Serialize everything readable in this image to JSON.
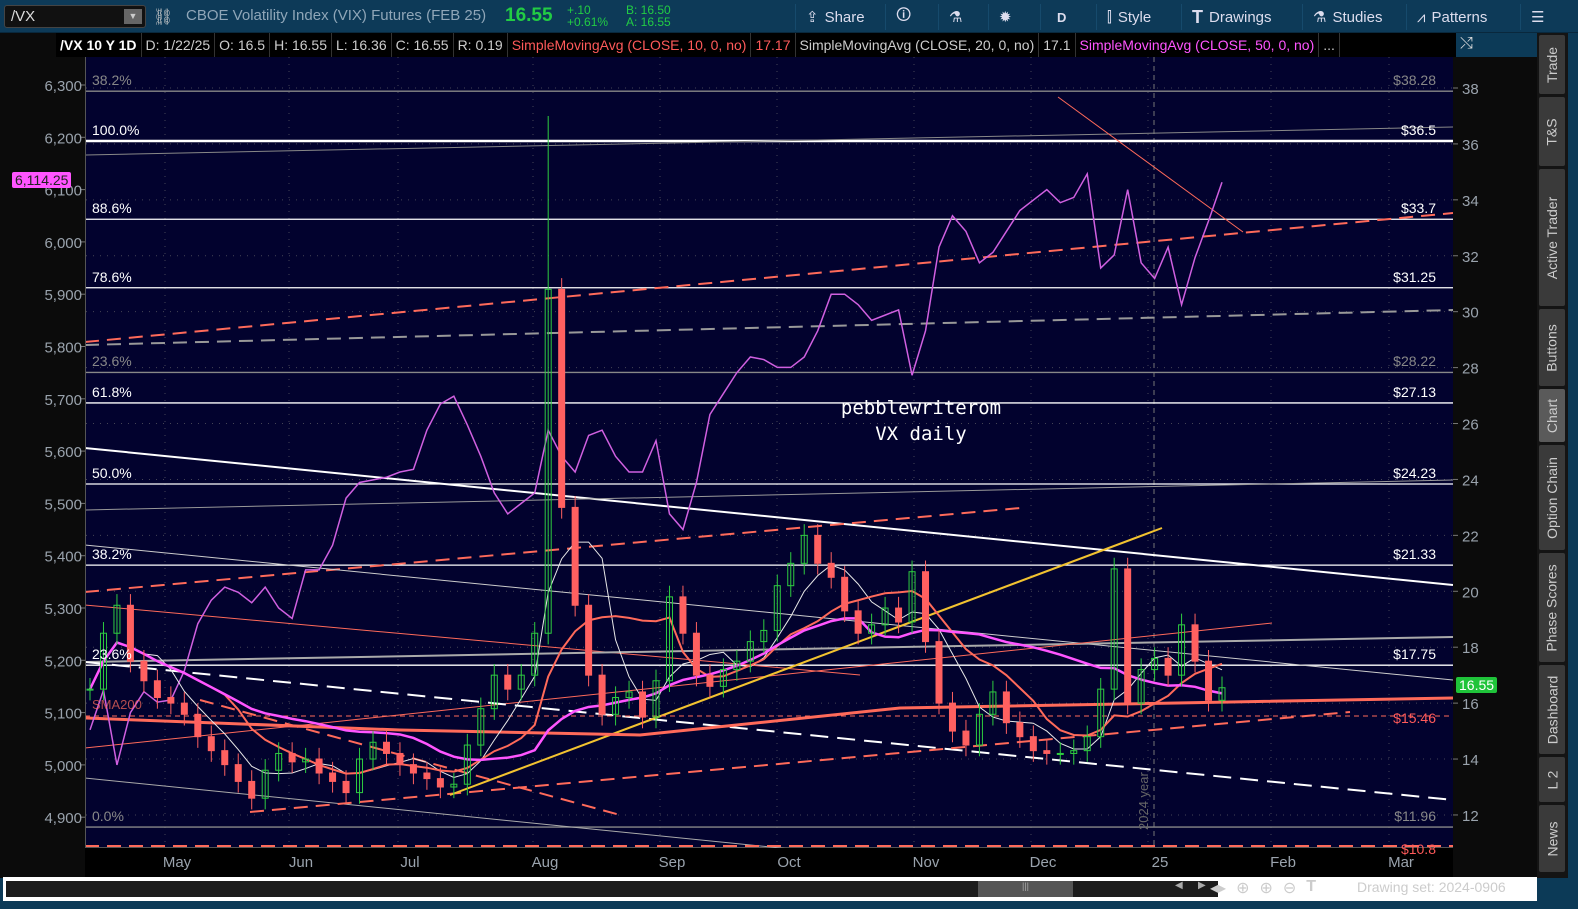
{
  "toolbar": {
    "symbol": "/VX",
    "description": "CBOE Volatility Index (VIX) Futures (FEB 25)",
    "last": "16.55",
    "change": "+.10",
    "change_pct": "+0.61%",
    "bid": "B: 16.50",
    "ask": "A: 16.55",
    "share": "Share",
    "period": "D",
    "style": "Style",
    "drawings": "Drawings",
    "studies": "Studies",
    "patterns": "Patterns"
  },
  "infobar": {
    "title": "/VX 10 Y 1D",
    "date": "D: 1/22/25",
    "open": "O: 16.5",
    "high": "H: 16.55",
    "low": "L: 16.36",
    "close": "C: 16.55",
    "range": "R: 0.19",
    "sma10": "SimpleMovingAvg (CLOSE, 10, 0, no)",
    "sma10_val": "17.17",
    "sma20": "SimpleMovingAvg (CLOSE, 20, 0, no)",
    "sma20_val": "17.1",
    "sma50": "SimpleMovingAvg (CLOSE, 50, 0, no)",
    "more": "..."
  },
  "sidebar": [
    "Trade",
    "T&S",
    "Active Trader",
    "Buttons",
    "Chart",
    "Option Chain",
    "Phase Scores",
    "Dashboard",
    "L 2",
    "News"
  ],
  "bottom": {
    "drawing_set": "Drawing set: 2024-0906"
  },
  "annotation": {
    "line1": "pebblewriterom",
    "line2": "VX daily",
    "year_marker": "2024 year",
    "sma_label": "SMA200"
  },
  "fib_left": [
    {
      "t": "38.2%",
      "v": 38.28,
      "c": "g"
    },
    {
      "t": "100.0%",
      "v": 36.5,
      "c": ""
    },
    {
      "t": "88.6%",
      "v": 33.7,
      "c": ""
    },
    {
      "t": "78.6%",
      "v": 31.25,
      "c": ""
    },
    {
      "t": "23.6%",
      "v": 28.22,
      "c": "g"
    },
    {
      "t": "61.8%",
      "v": 27.13,
      "c": ""
    },
    {
      "t": "50.0%",
      "v": 24.23,
      "c": ""
    },
    {
      "t": "38.2%",
      "v": 21.33,
      "c": ""
    },
    {
      "t": "23.6%",
      "v": 17.75,
      "c": ""
    },
    {
      "t": "0.0%",
      "v": 11.96,
      "c": "g"
    }
  ],
  "fib_right": [
    {
      "t": "$38.28",
      "v": 38.28,
      "c": "g"
    },
    {
      "t": "$36.5",
      "v": 36.5,
      "c": ""
    },
    {
      "t": "$33.7",
      "v": 33.7,
      "c": ""
    },
    {
      "t": "$31.25",
      "v": 31.25,
      "c": ""
    },
    {
      "t": "$28.22",
      "v": 28.22,
      "c": "g"
    },
    {
      "t": "$27.13",
      "v": 27.13,
      "c": ""
    },
    {
      "t": "$24.23",
      "v": 24.23,
      "c": ""
    },
    {
      "t": "$21.33",
      "v": 21.33,
      "c": ""
    },
    {
      "t": "$17.75",
      "v": 17.75,
      "c": ""
    },
    {
      "t": "$15.46",
      "v": 15.46,
      "c": "r"
    },
    {
      "t": "$11.96",
      "v": 11.96,
      "c": "g"
    },
    {
      "t": "$10.8",
      "v": 10.8,
      "c": "r"
    }
  ],
  "chart_data": {
    "type": "candlestick",
    "right_axis": {
      "min": 10.8,
      "max": 38.4,
      "ticks": [
        "38",
        "36",
        "34",
        "32",
        "30",
        "28",
        "26",
        "24",
        "22",
        "20",
        "18",
        "16",
        "14",
        "12"
      ]
    },
    "left_axis": {
      "min": 4840,
      "max": 6340,
      "ticks": [
        "6,300",
        "6,200",
        "6,100",
        "6,000",
        "5,900",
        "5,800",
        "5,700",
        "5,600",
        "5,500",
        "5,400",
        "5,300",
        "5,200",
        "5,100",
        "5,000",
        "4,900"
      ]
    },
    "x_ticks": [
      "May",
      "Jun",
      "Jul",
      "Aug",
      "Sep",
      "Oct",
      "Nov",
      "Dec",
      "25",
      "Feb",
      "Mar"
    ],
    "last_price": "16.55",
    "compare_last": "6,114.25",
    "colors": {
      "up": "#2ecc40",
      "down": "#ff6060",
      "sma10": "#ff6a5a",
      "sma20": "#e8e8e8",
      "sma50": "#ff55ff",
      "compare": "#d060e0"
    },
    "spike_high": 37,
    "closes": [
      16.5,
      18.5,
      19.5,
      17.5,
      16.8,
      16.2,
      16.0,
      15.6,
      14.8,
      14.3,
      13.8,
      13.2,
      12.6,
      13.6,
      14.2,
      13.9,
      14.0,
      13.5,
      13.2,
      12.8,
      14.0,
      14.6,
      14.2,
      13.8,
      13.5,
      13.3,
      13.0,
      13.1,
      14.5,
      15.8,
      17.0,
      16.5,
      17.0,
      18.5,
      30.8,
      23.0,
      19.5,
      17.0,
      15.6,
      16.2,
      16.4,
      15.5,
      16.8,
      19.8,
      18.5,
      17.0,
      16.6,
      17.2,
      17.5,
      18.2,
      18.6,
      20.2,
      21.0,
      22.0,
      21.0,
      20.5,
      19.3,
      18.5,
      18.8,
      19.4,
      18.9,
      20.7,
      18.2,
      16.0,
      15.0,
      14.5,
      15.6,
      16.4,
      15.3,
      14.8,
      14.3,
      14.2,
      14.2,
      14.3,
      14.8,
      16.5,
      20.8,
      16.0,
      17.2,
      17.6,
      17.0,
      18.8,
      17.5,
      16.1,
      16.55
    ],
    "compare_series": [
      5067,
      5143,
      5000,
      5100,
      5140,
      5120,
      5124,
      5180,
      5270,
      5315,
      5340,
      5330,
      5310,
      5340,
      5300,
      5280,
      5373,
      5373,
      5420,
      5510,
      5540,
      5545,
      5550,
      5560,
      5565,
      5640,
      5690,
      5705,
      5650,
      5590,
      5520,
      5480,
      5500,
      5520,
      5640,
      5590,
      5560,
      5630,
      5640,
      5590,
      5560,
      5560,
      5620,
      5480,
      5450,
      5540,
      5670,
      5710,
      5750,
      5780,
      5775,
      5760,
      5760,
      5780,
      5830,
      5900,
      5900,
      5880,
      5850,
      5860,
      5870,
      5745,
      5830,
      5990,
      6050,
      6020,
      5960,
      5980,
      6020,
      6060,
      6080,
      6100,
      6075,
      6085,
      6130,
      5950,
      5975,
      6100,
      5960,
      5930,
      5990,
      5880,
      5970,
      6040,
      6114
    ]
  }
}
